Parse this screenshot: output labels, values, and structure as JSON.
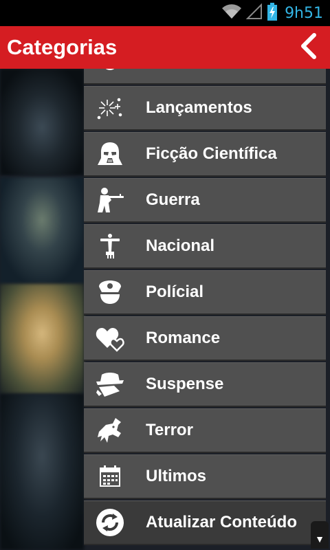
{
  "status_bar": {
    "time": "9h51"
  },
  "app_bar": {
    "title": "Categorias"
  },
  "categories": [
    {
      "label": "Lançamentos",
      "icon": "fireworks-icon"
    },
    {
      "label": "Ficção Científica",
      "icon": "darth-vader-helmet-icon"
    },
    {
      "label": "Guerra",
      "icon": "soldier-rifle-icon"
    },
    {
      "label": "Nacional",
      "icon": "christ-redeemer-icon"
    },
    {
      "label": "Polícial",
      "icon": "police-cap-icon"
    },
    {
      "label": "Romance",
      "icon": "hearts-icon"
    },
    {
      "label": "Suspense",
      "icon": "detective-hat-icon"
    },
    {
      "label": "Terror",
      "icon": "werewolf-icon"
    },
    {
      "label": "Ultimos",
      "icon": "calendar-icon"
    },
    {
      "label": "Atualizar Conteúdo",
      "icon": "refresh-icon"
    }
  ],
  "colors": {
    "app_bar": "#d51d22",
    "clock": "#33b5e5",
    "item_bg": "#505050",
    "background": "#1b1f27"
  }
}
